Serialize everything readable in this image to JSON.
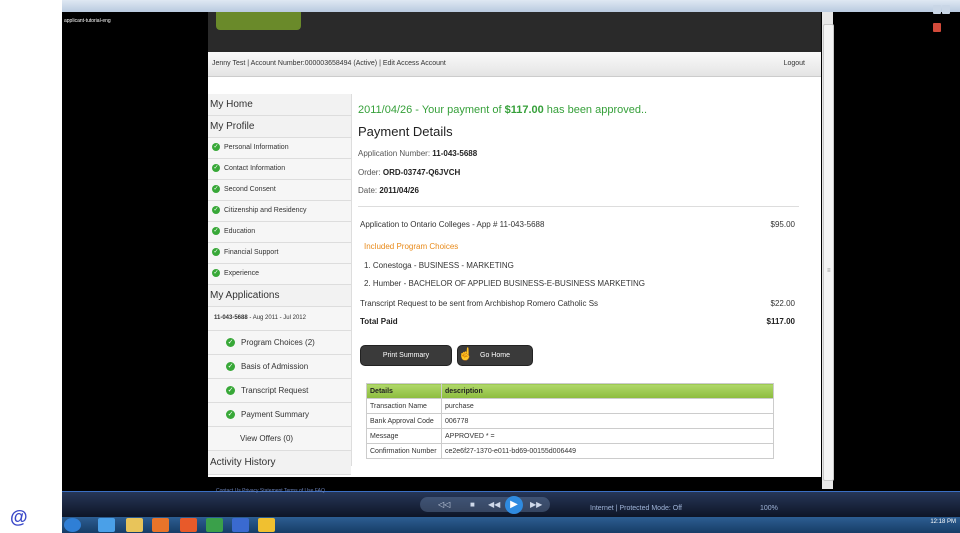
{
  "overlay_label": "applicant-tutorial-eng",
  "window": {
    "title": ""
  },
  "userbar": {
    "info": "Jenny Test  |  Account Number:000003658494  (Active)  |  Edit Access Account",
    "logout": "Logout"
  },
  "sidebar": {
    "my_home": "My Home",
    "my_profile": "My Profile",
    "profile_items": [
      "Personal Information",
      "Contact Information",
      "Second Consent",
      "Citizenship and Residency",
      "Education",
      "Financial Support",
      "Experience"
    ],
    "my_applications": "My Applications",
    "app_number": "11-043-5688",
    "app_period": " - Aug 2011 - Jul 2012",
    "app_items": [
      "Program Choices (2)",
      "Basis of Admission",
      "Transcript Request",
      "Payment Summary"
    ],
    "view_offers": "View Offers (0)",
    "activity_history": "Activity History"
  },
  "main": {
    "message_prefix": "2011/04/26 - Your payment of ",
    "message_amount": "$117.00",
    "message_suffix": " has been approved..",
    "title": "Payment Details",
    "app_number_label": "Application Number: ",
    "app_number_value": "11-043-5688",
    "order_label": "Order: ",
    "order_value": "ORD-03747-Q6JVCH",
    "date_label": "Date: ",
    "date_value": "2011/04/26",
    "line1": "Application to Ontario Colleges - App # 11-043-5688",
    "line1_amount": "$95.00",
    "programs_heading": "Included Program Choices",
    "program1": "1. Conestoga - BUSINESS - MARKETING",
    "program2": "2. Humber - BACHELOR OF APPLIED BUSINESS-E-BUSINESS MARKETING",
    "line2": "Transcript Request to be sent from Archbishop Romero Catholic Ss",
    "line2_amount": "$22.00",
    "total_label": "Total Paid",
    "total_amount": "$117.00",
    "print_button": "Print Summary",
    "home_button": "Go Home"
  },
  "details_table": {
    "headers": [
      "Details",
      "description"
    ],
    "rows": [
      [
        "Transaction Name",
        "purchase"
      ],
      [
        "Bank Approval Code",
        "006778"
      ],
      [
        "Message",
        "APPROVED * ="
      ],
      [
        "Confirmation Number",
        "ce2e6f27-1370-e011-bd69-00155d006449"
      ]
    ]
  },
  "footer": {
    "links": "Contact Us    Privacy Statement    Terms of Use    FAQ"
  },
  "media_player": {
    "status": "Internet | Protected Mode: Off",
    "zoom": "100%"
  },
  "tray": {
    "time": "12:18 PM"
  },
  "colors": {
    "accent_green": "#36a03a",
    "orange": "#e88a1a",
    "table_header": "#9cc94e"
  },
  "icons": [
    "check-circle-icon",
    "cursor-hand-icon",
    "play-icon",
    "ie-logo-icon"
  ]
}
